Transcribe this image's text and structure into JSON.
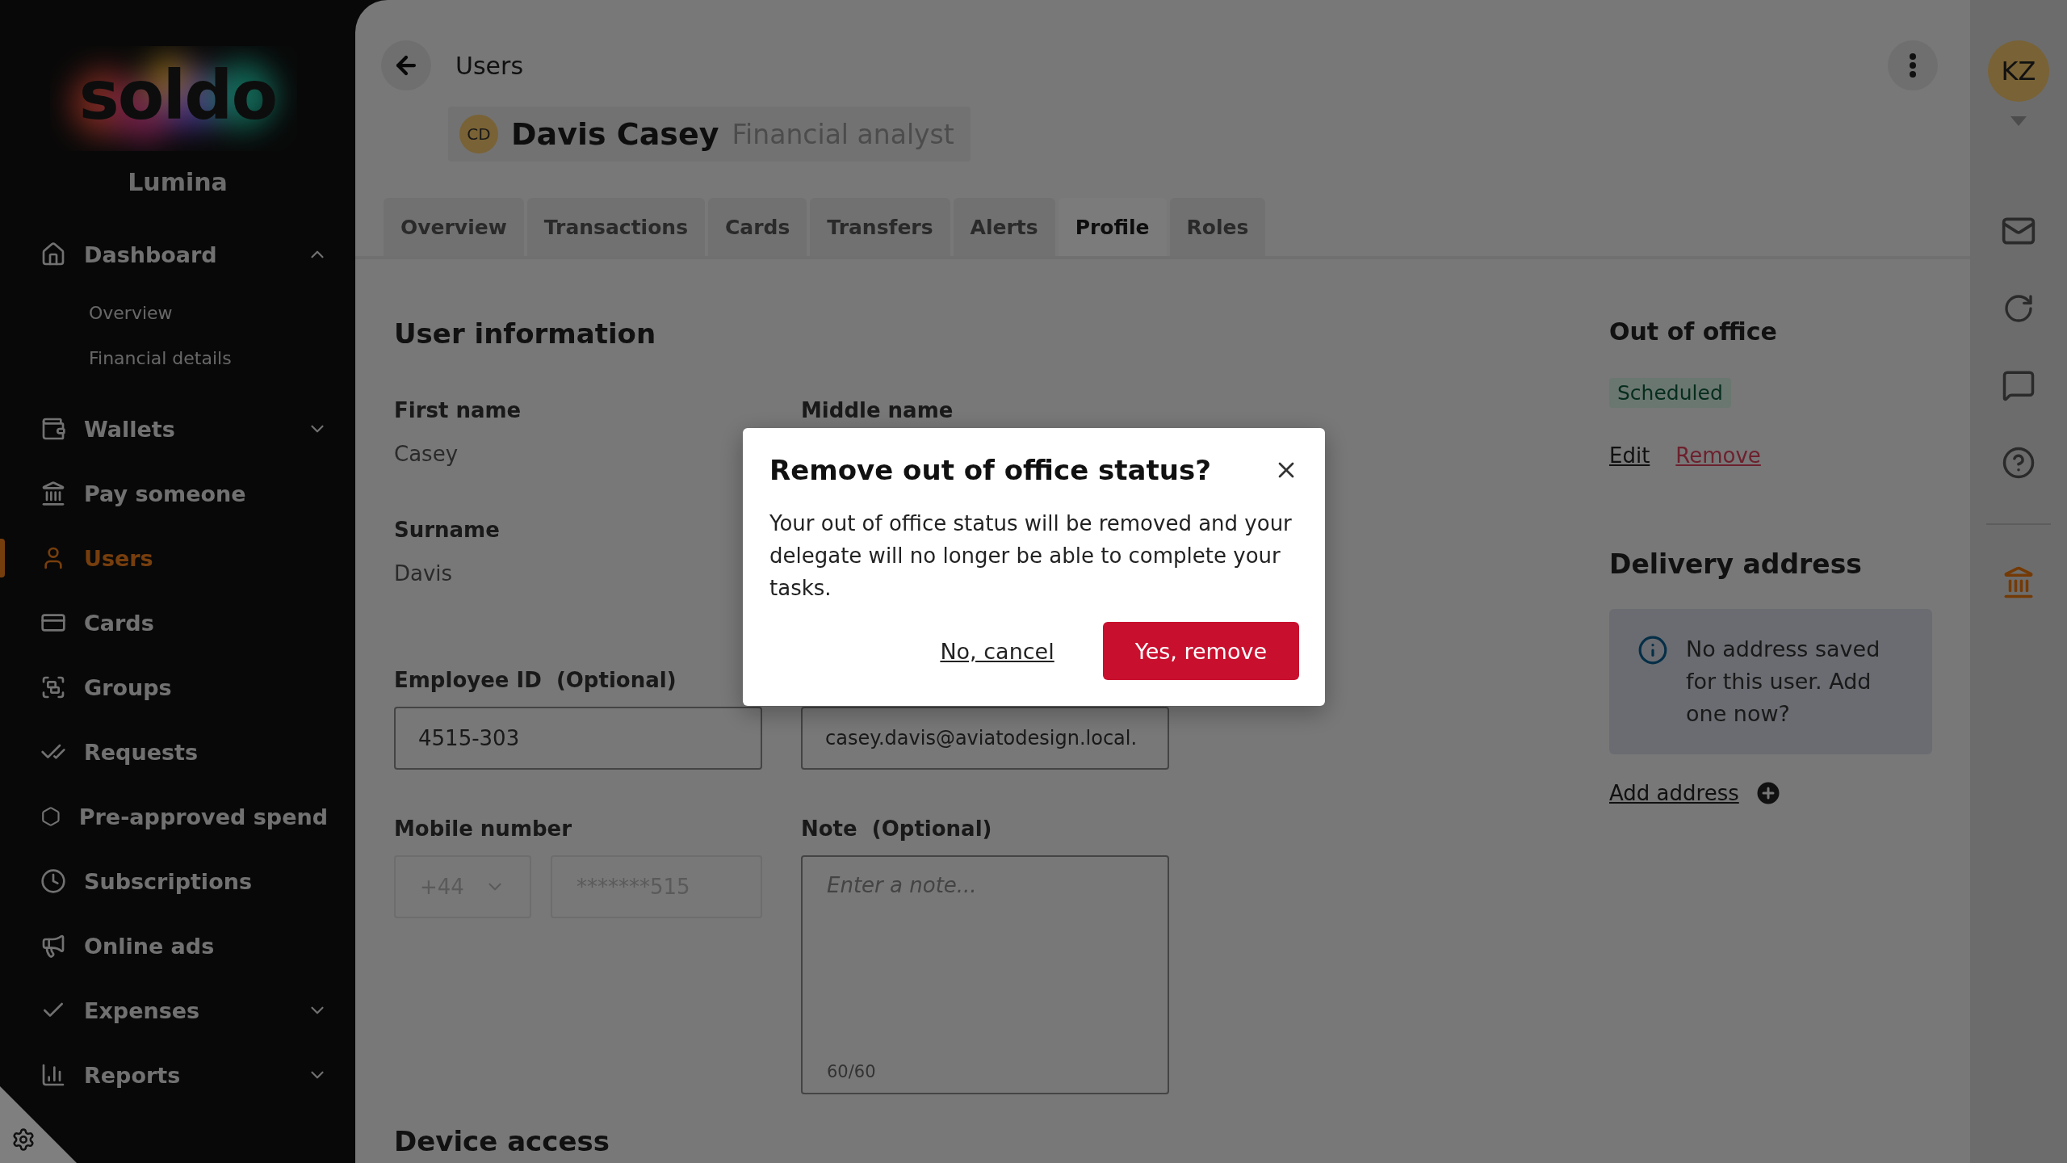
{
  "sidebar": {
    "logo": "soldo",
    "company": "Lumina",
    "items": [
      {
        "label": "Dashboard",
        "selected": false,
        "expanded": true,
        "children": [
          {
            "label": "Overview",
            "selected": false
          },
          {
            "label": "Financial details",
            "selected": false
          }
        ]
      },
      {
        "label": "Wallets",
        "selected": false,
        "expanded": false
      },
      {
        "label": "Pay someone",
        "selected": false
      },
      {
        "label": "Users",
        "selected": true
      },
      {
        "label": "Cards",
        "selected": false
      },
      {
        "label": "Groups",
        "selected": false
      },
      {
        "label": "Requests",
        "selected": false
      },
      {
        "label": "Pre-approved spend",
        "selected": false
      },
      {
        "label": "Subscriptions",
        "selected": false
      },
      {
        "label": "Online ads",
        "selected": false
      },
      {
        "label": "Expenses",
        "selected": false,
        "expanded": false
      },
      {
        "label": "Reports",
        "selected": false,
        "expanded": false
      }
    ]
  },
  "header": {
    "back_label": "Users",
    "initials": "CD",
    "name": "Davis Casey",
    "role": "Financial analyst"
  },
  "tabs": [
    {
      "label": "Overview",
      "selected": false
    },
    {
      "label": "Transactions",
      "selected": false
    },
    {
      "label": "Cards",
      "selected": false
    },
    {
      "label": "Transfers",
      "selected": false
    },
    {
      "label": "Alerts",
      "selected": false
    },
    {
      "label": "Profile",
      "selected": true
    },
    {
      "label": "Roles",
      "selected": false
    }
  ],
  "user_information": {
    "title": "User information",
    "first_name": {
      "label": "First name",
      "value": "Casey"
    },
    "middle_name": {
      "label": "Middle name"
    },
    "surname": {
      "label": "Surname",
      "value": "Davis"
    },
    "employee_id": {
      "label": "Employee ID",
      "optional": "(Optional)",
      "value": "4515-303"
    },
    "email": {
      "value": "casey.davis@aviatodesign.local."
    },
    "mobile": {
      "label": "Mobile number",
      "country_code": "+44",
      "number": "*******515",
      "disabled": true
    },
    "note": {
      "label": "Note",
      "optional": "(Optional)",
      "placeholder": "Enter a note...",
      "counter": "60/60"
    },
    "device_access_title": "Device access"
  },
  "out_of_office": {
    "title": "Out of office",
    "status": "Scheduled",
    "edit": "Edit",
    "remove": "Remove"
  },
  "delivery_address": {
    "title": "Delivery address",
    "message": "No address saved for this user. Add one now?",
    "add": "Add address"
  },
  "right_rail": {
    "avatar": "KZ"
  },
  "dialog": {
    "title": "Remove out of office status?",
    "body": "Your out of office status will be removed and your delegate will no longer be able to complete your tasks.",
    "cancel": "No, cancel",
    "confirm": "Yes, remove"
  }
}
